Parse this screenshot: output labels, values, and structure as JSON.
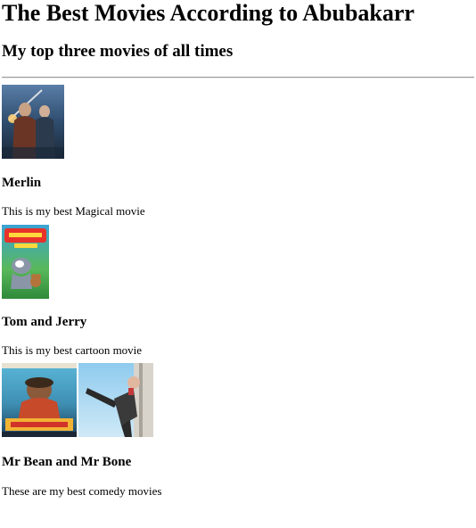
{
  "header": {
    "title": "The Best Movies According to Abubakarr",
    "subtitle": "My top three movies of all times"
  },
  "movies": [
    {
      "title": "Merlin",
      "description": "This is my best Magical movie",
      "posters": [
        "merlin-poster"
      ]
    },
    {
      "title": "Tom and Jerry",
      "description": "This is my best cartoon movie",
      "posters": [
        "tom-and-jerry-poster"
      ]
    },
    {
      "title": "Mr Bean and Mr Bone",
      "description": "These are my best comedy movies",
      "posters": [
        "mr-bones-poster",
        "mr-bean-poster"
      ]
    }
  ],
  "colors": {
    "text": "#000000",
    "background": "#ffffff",
    "rule": "#9a9a9a"
  }
}
